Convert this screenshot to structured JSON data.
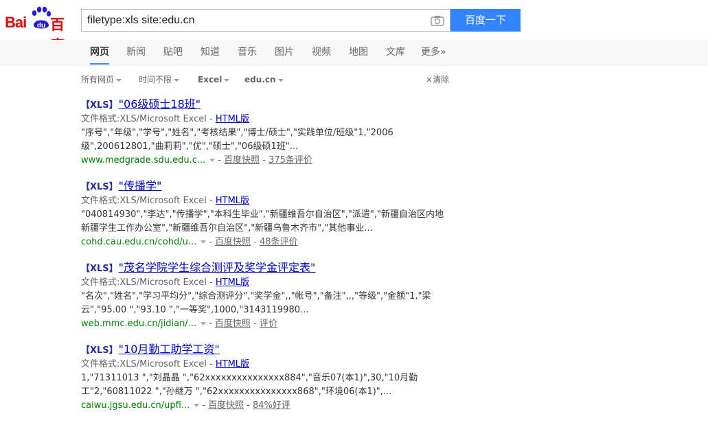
{
  "logo": {
    "latin": "Bai",
    "paw_text": "du",
    "chinese": "百度"
  },
  "search": {
    "query": "filetype:xls site:edu.cn",
    "button": "百度一下"
  },
  "nav": [
    {
      "label": "网页",
      "active": true
    },
    {
      "label": "新闻"
    },
    {
      "label": "贴吧"
    },
    {
      "label": "知道"
    },
    {
      "label": "音乐"
    },
    {
      "label": "图片"
    },
    {
      "label": "视频"
    },
    {
      "label": "地图"
    },
    {
      "label": "文库"
    },
    {
      "label": "更多»"
    }
  ],
  "tools": [
    {
      "label": "所有网页"
    },
    {
      "label": "时间不限"
    },
    {
      "label": "Excel"
    },
    {
      "label": "edu.cn"
    }
  ],
  "clear": "清除",
  "results": [
    {
      "tag": "【XLS】",
      "title": "\"06级硕士18班\"",
      "format_label": "文件格式:",
      "format": "XLS/Microsoft Excel",
      "html_link": "HTML版",
      "abstract": "\"序号\",\"年级\",\"学号\",\"姓名\",\"考核结果\",\"博士/硕士\",\"实践单位/班级\"1,\"2006级\",200612801,\"曲莉莉\",\"优\",\"硕士\",\"06级硕1班\"...",
      "url": "www.medgrade.sdu.edu.c...",
      "snapshot": "百度快照",
      "reviews": "375条评价"
    },
    {
      "tag": "【XLS】",
      "title": "\"传播学\"",
      "format_label": "文件格式:",
      "format": "XLS/Microsoft Excel",
      "html_link": "HTML版",
      "abstract": "\"040814930\",\"李达\",\"传播学\",\"本科生毕业\",\"新疆维吾尔自治区\",\"派遣\",\"新疆自治区内地新疆学生工作办公室\",\"新疆维吾尔自治区\",\"新疆乌鲁木齐市\",\"其他事业...",
      "url": "cohd.cau.edu.cn/cohd/u...",
      "snapshot": "百度快照",
      "reviews": "48条评价"
    },
    {
      "tag": "【XLS】",
      "title": "\"茂名学院学生综合测评及奖学金评定表\"",
      "format_label": "文件格式:",
      "format": "XLS/Microsoft Excel",
      "html_link": "HTML版",
      "abstract": "\"名次\",\"姓名\",\"学习平均分\",\"综合测评分\",\"奖学金\",,\"帐号\",\"备注\",,,\"等级\",\"金额\"1,\"梁云\",\"95.00 \",\"93.10 \",\"一等奖\",1000,\"3143119980...",
      "url": "web.mmc.edu.cn/jidian/...",
      "snapshot": "百度快照",
      "reviews": "评价"
    },
    {
      "tag": "【XLS】",
      "title": "\"10月勤工助学工资\"",
      "format_label": "文件格式:",
      "format": "XLS/Microsoft Excel",
      "html_link": "HTML版",
      "abstract": "1,\"71311013 \",\"刘晶晶 \",\"62xxxxxxxxxxxxxxx884\",\"音乐07(本1)\",30,\"10月勤工\"2,\"60811022 \",\"孙继万 \",\"62xxxxxxxxxxxxxxx868\",\"环境06(本1)\",...",
      "url": "caiwu.jgsu.edu.cn/upfi...",
      "snapshot": "百度快照",
      "reviews": "84%好评"
    }
  ]
}
